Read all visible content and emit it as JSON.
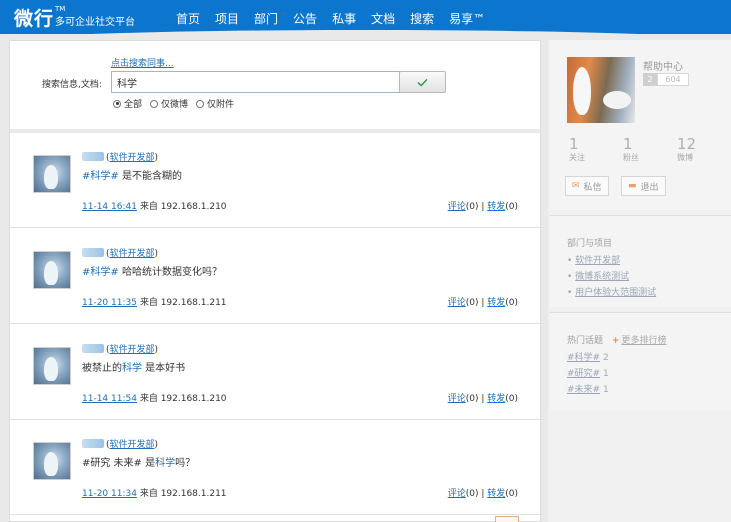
{
  "header": {
    "logo": "微行",
    "logo_tm": "TM",
    "logo_sub": "多可企业社交平台",
    "nav": [
      "首页",
      "项目",
      "部门",
      "公告",
      "私事",
      "文档",
      "搜索",
      "易享™"
    ]
  },
  "search": {
    "hint": "点击搜索同事...",
    "label": "搜索信息,文档:",
    "value": "科学",
    "options": [
      {
        "label": "全部",
        "checked": true
      },
      {
        "label": "仅微博",
        "checked": false
      },
      {
        "label": "仅附件",
        "checked": false
      }
    ]
  },
  "posts": [
    {
      "dept": "软件开发部",
      "body_parts": [
        {
          "text": "#科学#",
          "hl": true
        },
        {
          "text": " 是不能含糊的",
          "hl": false
        }
      ],
      "time": "11-14 16:41",
      "source": "来自 192.168.1.210",
      "comment": "评论",
      "comment_count": "(0)",
      "forward": "转发",
      "forward_count": "(0)"
    },
    {
      "dept": "软件开发部",
      "body_parts": [
        {
          "text": "#科学#",
          "hl": true
        },
        {
          "text": " 哈哈统计数据变化吗？",
          "hl": false
        }
      ],
      "time": "11-20 11:35",
      "source": "来自 192.168.1.211",
      "comment": "评论",
      "comment_count": "(0)",
      "forward": "转发",
      "forward_count": "(0)"
    },
    {
      "dept": "软件开发部",
      "body_parts": [
        {
          "text": "被禁止的",
          "hl": false
        },
        {
          "text": "科学",
          "hl": true
        },
        {
          "text": " 是本好书",
          "hl": false
        }
      ],
      "time": "11-14 11:54",
      "source": "来自 192.168.1.210",
      "comment": "评论",
      "comment_count": "(0)",
      "forward": "转发",
      "forward_count": "(0)"
    },
    {
      "dept": "软件开发部",
      "body_parts": [
        {
          "text": "#研究 未来# 是",
          "hl": false
        },
        {
          "text": "科学",
          "hl": true
        },
        {
          "text": "吗？",
          "hl": false
        }
      ],
      "time": "11-20 11:34",
      "source": "来自 192.168.1.211",
      "comment": "评论",
      "comment_count": "(0)",
      "forward": "转发",
      "forward_count": "(0)"
    }
  ],
  "sidebar": {
    "help": "帮助中心",
    "level_badge": "2",
    "level_value": "604",
    "stats": [
      {
        "num": "1",
        "label": "关注"
      },
      {
        "num": "1",
        "label": "粉丝"
      },
      {
        "num": "12",
        "label": "微博"
      }
    ],
    "btn_message": "私信",
    "btn_logout": "退出",
    "dept_title": "部门与项目",
    "dept_items": [
      "软件开发部",
      "微博系统测试",
      "用户体验大范围测试"
    ],
    "topics_title": "热门话题",
    "topics_more": "更多排行榜",
    "topics": [
      {
        "name": "#科学#",
        "count": "2"
      },
      {
        "name": "#研究#",
        "count": "1"
      },
      {
        "name": "#未来#",
        "count": "1"
      }
    ]
  },
  "colors": {
    "header_bg": "#0c76cf",
    "link": "#1e6fb8",
    "accent": "#f08a30"
  }
}
